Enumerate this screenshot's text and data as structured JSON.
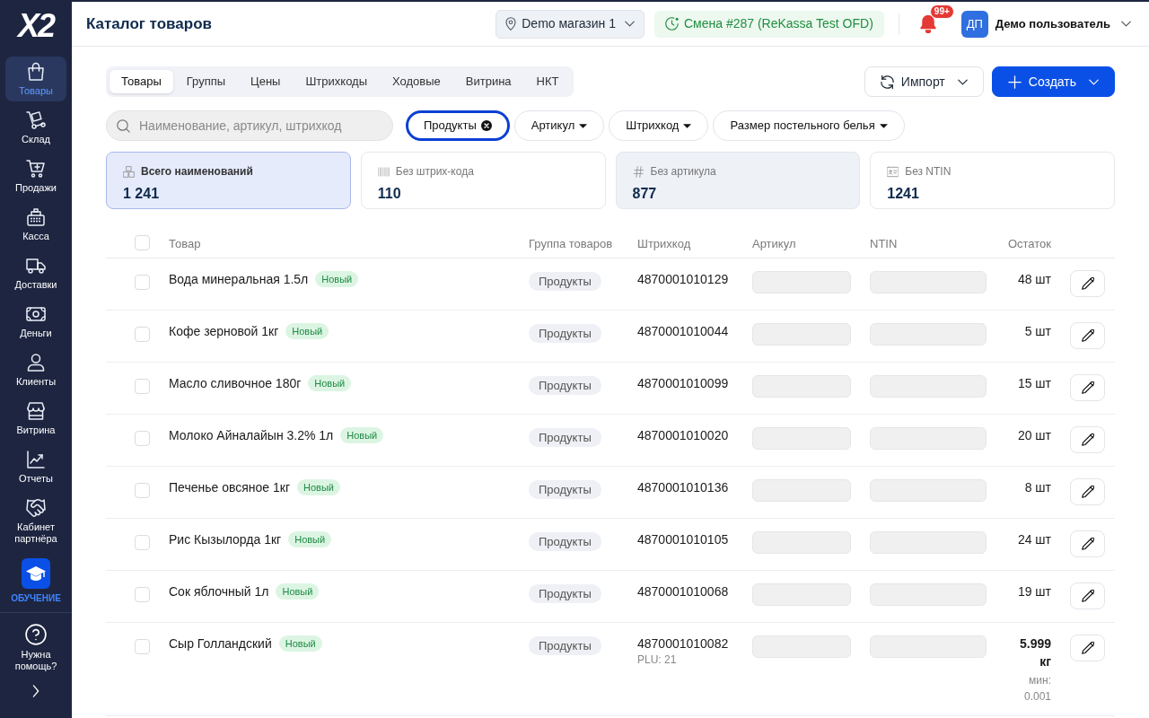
{
  "sidebar": {
    "logo": "X2",
    "items": [
      {
        "label": "Товары",
        "selected": true
      },
      {
        "label": "Склад",
        "selected": false
      },
      {
        "label": "Продажи",
        "selected": false
      },
      {
        "label": "Касса",
        "selected": false
      },
      {
        "label": "Доставки",
        "selected": false
      },
      {
        "label": "Деньги",
        "selected": false
      },
      {
        "label": "Клиенты",
        "selected": false
      },
      {
        "label": "Витрина",
        "selected": false
      },
      {
        "label": "Отчеты",
        "selected": false
      },
      {
        "label": "Кабинет партнёра",
        "selected": false
      }
    ],
    "training": "ОБУЧЕНИЕ",
    "help": "Нужна помощь?"
  },
  "header": {
    "title": "Каталог товаров",
    "store": "Demo магазин 1",
    "shift": "Смена #287 (ReKassa Test OFD)",
    "notifications": "99+",
    "user": {
      "initials": "ДП",
      "name": "Демо пользователь"
    }
  },
  "tabs": [
    {
      "label": "Товары",
      "selected": true
    },
    {
      "label": "Группы",
      "selected": false
    },
    {
      "label": "Цены",
      "selected": false
    },
    {
      "label": "Штрихкоды",
      "selected": false
    },
    {
      "label": "Ходовые",
      "selected": false
    },
    {
      "label": "Витрина",
      "selected": false
    },
    {
      "label": "НКТ",
      "selected": false
    }
  ],
  "actions": [
    {
      "label": "Импорт",
      "kind": "secondary"
    },
    {
      "label": "Создать",
      "kind": "primary"
    }
  ],
  "search": {
    "placeholder": "Наименование, артикул, штрихкод"
  },
  "filters": [
    {
      "label": "Продукты",
      "active": true
    },
    {
      "label": "Артикул",
      "active": false
    },
    {
      "label": "Штрихкод",
      "active": false
    },
    {
      "label": "Размер постельного белья",
      "active": false
    }
  ],
  "stats": [
    {
      "label": "Всего наименований",
      "value": "1 241",
      "selected": true,
      "hovered": false
    },
    {
      "label": "Без штрих-кода",
      "value": "110",
      "selected": false,
      "hovered": false
    },
    {
      "label": "Без артикула",
      "value": "877",
      "selected": false,
      "hovered": true
    },
    {
      "label": "Без NTIN",
      "value": "1241",
      "selected": false,
      "hovered": false
    }
  ],
  "table": {
    "columns": [
      "Товар",
      "Группа товаров",
      "Штрихкод",
      "Артикул",
      "NTIN",
      "Остаток"
    ],
    "select_all_checked": false,
    "rows": [
      {
        "kind": "piece",
        "checked": false,
        "name": "Вода минеральная 1.5л",
        "badge": "Новый",
        "group": "Продукты",
        "barcode": "4870001010129",
        "quantity": "48 шт"
      },
      {
        "kind": "piece",
        "checked": false,
        "name": "Кофе зерновой 1кг",
        "badge": "Новый",
        "group": "Продукты",
        "barcode": "4870001010044",
        "quantity": "5 шт"
      },
      {
        "kind": "piece",
        "checked": false,
        "name": "Масло сливочное 180г",
        "badge": "Новый",
        "group": "Продукты",
        "barcode": "4870001010099",
        "quantity": "15 шт"
      },
      {
        "kind": "piece",
        "checked": false,
        "name": "Молоко Айналайын 3.2% 1л",
        "badge": "Новый",
        "group": "Продукты",
        "barcode": "4870001010020",
        "quantity": "20 шт"
      },
      {
        "kind": "piece",
        "checked": false,
        "name": "Печенье овсяное 1кг",
        "badge": "Новый",
        "group": "Продукты",
        "barcode": "4870001010136",
        "quantity": "8 шт"
      },
      {
        "kind": "piece",
        "checked": false,
        "name": "Рис Кызылорда 1кг",
        "badge": "Новый",
        "group": "Продукты",
        "barcode": "4870001010105",
        "quantity": "24 шт"
      },
      {
        "kind": "piece",
        "checked": false,
        "name": "Сок яблочный 1л",
        "badge": "Новый",
        "group": "Продукты",
        "barcode": "4870001010068",
        "quantity": "19 шт"
      },
      {
        "kind": "weighted",
        "checked": false,
        "name": "Сыр Голландский",
        "badge": "Новый",
        "group": "Продукты",
        "barcode": "4870001010082",
        "plu": "PLU: 21",
        "quantity": "5.999 кг",
        "minimum": "мин: 0.001"
      }
    ]
  }
}
